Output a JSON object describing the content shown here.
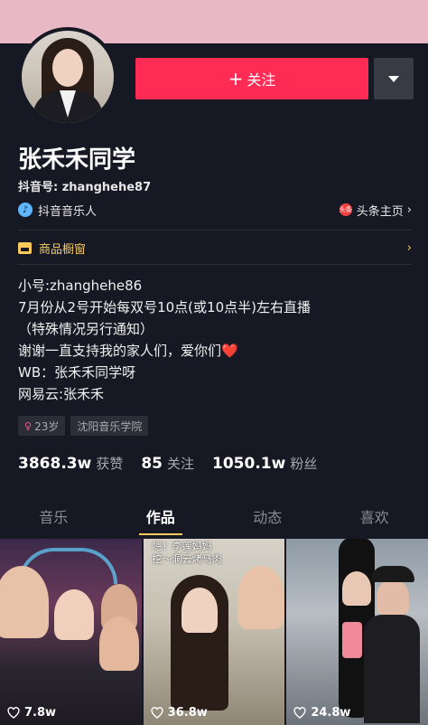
{
  "profile": {
    "name": "张禾禾同学",
    "douyin_id": "抖音号: zhanghehe87",
    "badge_label": "抖音音乐人",
    "toutiao_icon_text": "头条",
    "toutiao_label": "头条主页",
    "shop_label": "商品橱窗"
  },
  "actions": {
    "follow_plus": "+",
    "follow_label": "关注"
  },
  "bio": {
    "line1": "小号:zhanghehe86",
    "line2": "7月份从2号开始每双号10点(或10点半)左右直播",
    "line3": "（特殊情况另行通知）",
    "line4": "谢谢一直支持我的家人们，爱你们",
    "line4_emoji": "❤️",
    "line5": "WB：张禾禾同学呀",
    "line6": "网易云:张禾禾"
  },
  "tags": {
    "gender_symbol": "♀",
    "age": "23岁",
    "school": "沈阳音乐学院"
  },
  "stats": {
    "likes_num": "3868.3w",
    "likes_label": "获赞",
    "following_num": "85",
    "following_label": "关注",
    "followers_num": "1050.1w",
    "followers_label": "粉丝"
  },
  "tabs": [
    "音乐",
    "作品",
    "动态",
    "喜欢"
  ],
  "videos": [
    {
      "likes": "7.8w",
      "caption": ""
    },
    {
      "likes": "36.8w",
      "caption": "嗯！李莲妈妈\n挖～洞云烤马肉"
    },
    {
      "likes": "24.8w",
      "caption": ""
    }
  ],
  "colors": {
    "background": "#161823",
    "accent": "#fe2c55",
    "highlight": "#facb5c",
    "banner": "#e8b8c4"
  },
  "icons": [
    "chevron-down-icon",
    "music-badge-icon",
    "toutiao-icon",
    "chevron-right-icon",
    "shop-icon",
    "heart-icon"
  ]
}
